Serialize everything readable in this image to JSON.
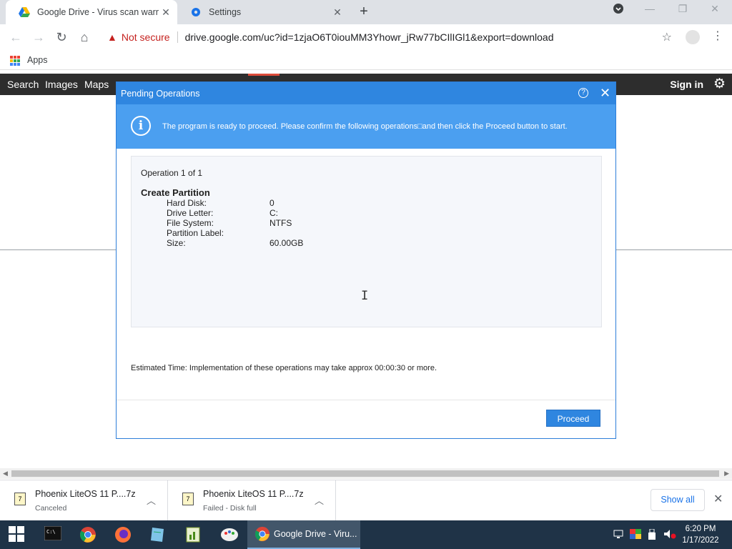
{
  "browser": {
    "tabs": [
      {
        "title": "Google Drive - Virus scan warnin",
        "active": true,
        "icon": "google-drive-icon"
      },
      {
        "title": "Settings",
        "active": false,
        "icon": "settings-gear-icon"
      }
    ],
    "omnibox": {
      "security_label": "Not secure",
      "url": "drive.google.com/uc?id=1zjaO6T0iouMM3Yhowr_jRw77bCIlIGl1&export=download"
    },
    "bookmarks": {
      "apps_label": "Apps"
    }
  },
  "google_bar": {
    "items": [
      "Search",
      "Images",
      "Maps"
    ],
    "sign_in": "Sign in"
  },
  "dialog": {
    "title": "Pending Operations",
    "info_message": "The program is ready to proceed. Please confirm the following operations□and then click the Proceed button to start.",
    "operation_header": "Operation 1 of 1",
    "operation_name": "Create Partition",
    "fields": [
      {
        "key": "Hard Disk:",
        "value": "0"
      },
      {
        "key": "Drive Letter:",
        "value": "C:"
      },
      {
        "key": "File System:",
        "value": "NTFS"
      },
      {
        "key": "Partition Label:",
        "value": ""
      },
      {
        "key": "Size:",
        "value": "60.00GB"
      }
    ],
    "estimated_time": "Estimated Time: Implementation of these operations may take approx 00:00:30 or more.",
    "proceed_label": "Proceed"
  },
  "downloads": {
    "items": [
      {
        "name": "Phoenix LiteOS 11 P....7z",
        "status": "Canceled"
      },
      {
        "name": "Phoenix LiteOS 11 P....7z",
        "status": "Failed - Disk full"
      }
    ],
    "show_all_label": "Show all"
  },
  "taskbar": {
    "active_task_label": "Google Drive - Viru...",
    "time": "6:20 PM",
    "date": "1/17/2022"
  },
  "colors": {
    "dialog_title_bg": "#2f86e0",
    "dialog_info_bg": "#4b9ff0",
    "not_secure": "#c5221f",
    "taskbar_bg": "#1f3347"
  }
}
